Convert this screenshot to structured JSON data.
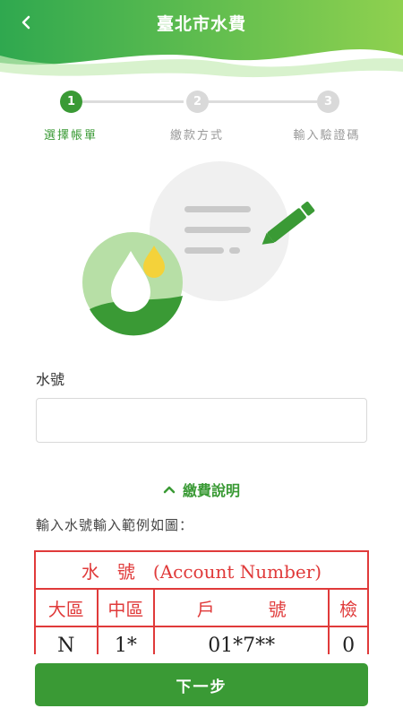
{
  "header": {
    "title": "臺北市水費",
    "back_icon": "chevron-left-icon"
  },
  "stepper": {
    "steps": [
      {
        "number": "1",
        "label": "選擇帳單",
        "state": "active"
      },
      {
        "number": "2",
        "label": "繳款方式",
        "state": "inactive"
      },
      {
        "number": "3",
        "label": "輸入驗證碼",
        "state": "inactive"
      }
    ]
  },
  "form": {
    "water_number_label": "水號",
    "water_number_value": "",
    "water_number_placeholder": ""
  },
  "help": {
    "toggle_label": "繳費說明",
    "toggle_icon": "chevron-up-icon",
    "example_text": "輸入水號輸入範例如圖："
  },
  "sample_bill": {
    "title": "水　號　(Account Number)",
    "headers": [
      "大區",
      "中區",
      "戶　　　號",
      "檢"
    ],
    "values": [
      "N",
      "1*",
      "01*7**",
      "0"
    ]
  },
  "actions": {
    "next_label": "下一步"
  },
  "colors": {
    "brand": "#3a9a35",
    "header_gradient_start": "#2fa84f",
    "header_gradient_end": "#8fd14f",
    "sample_red": "#e03a3a"
  }
}
